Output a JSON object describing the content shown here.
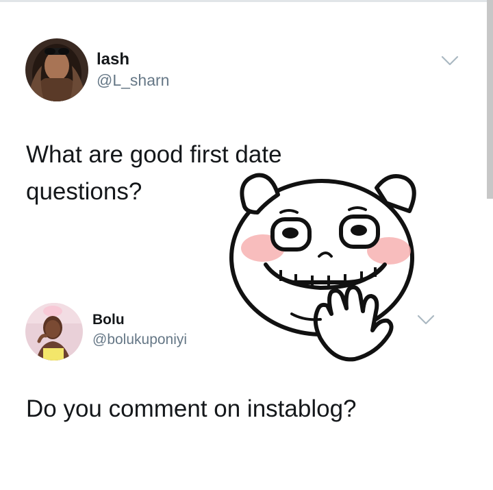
{
  "tweets": [
    {
      "name": "lash",
      "handle": "@L_sharn",
      "text": "What are good first date questions?",
      "avatar_icon": "avatar-photo"
    },
    {
      "name": "Bolu",
      "handle": "@bolukuponiyi",
      "text": "Do you comment on instablog?",
      "avatar_icon": "avatar-photo"
    }
  ],
  "sticker": {
    "icon": "grinning-waving-pig-sticker"
  },
  "colors": {
    "name_text": "#14171a",
    "handle_text": "#657786",
    "chevron": "#aab8c2",
    "blush": "#f6a7a7"
  }
}
